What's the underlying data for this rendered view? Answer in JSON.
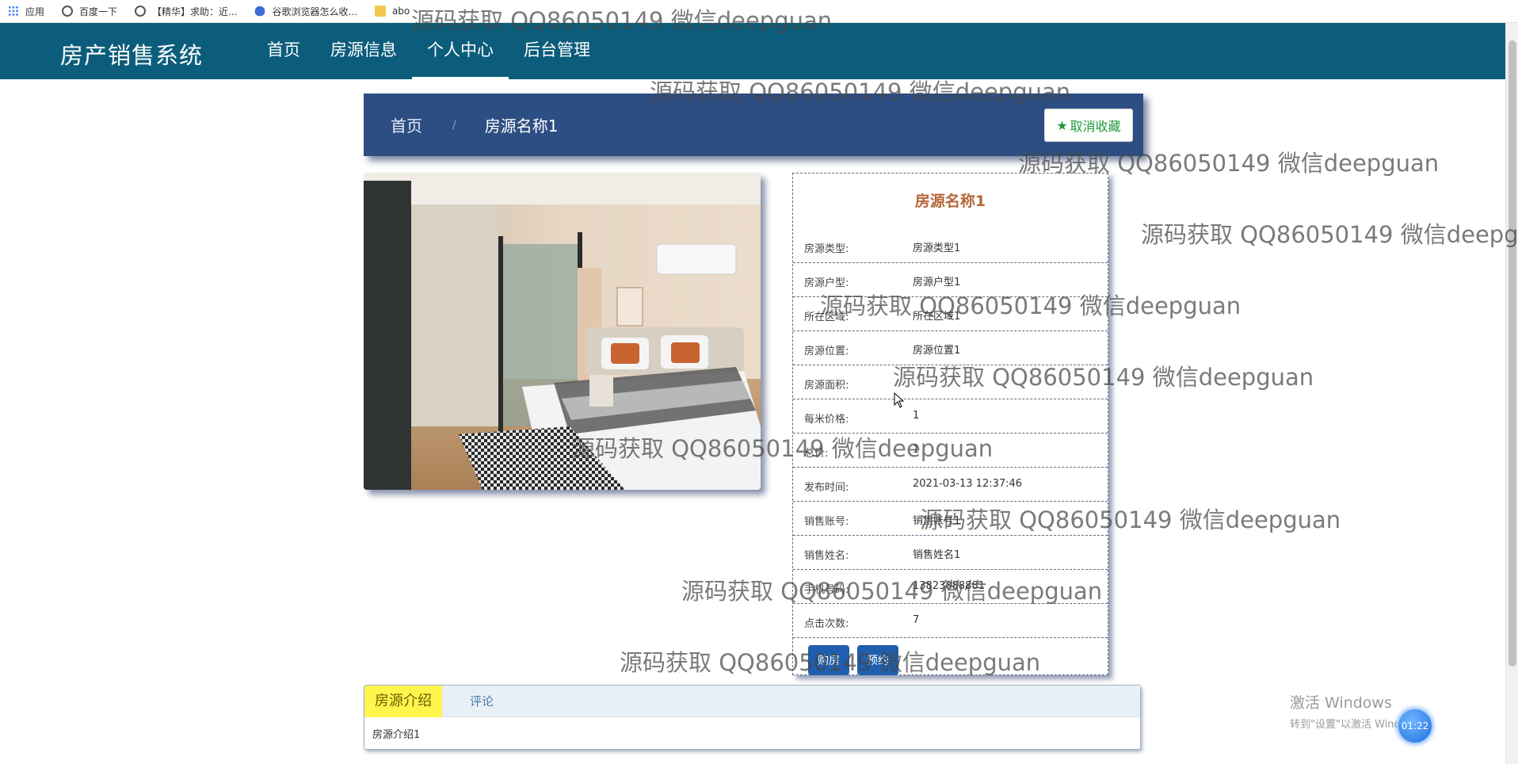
{
  "bookmarks": [
    {
      "label": "应用",
      "icon": "apps-grid-icon"
    },
    {
      "label": "百度一下",
      "icon": "globe-icon"
    },
    {
      "label": "【精华】求助：近...",
      "icon": "globe-icon"
    },
    {
      "label": "谷歌浏览器怎么收...",
      "icon": "paw-icon"
    },
    {
      "label": "abo",
      "icon": "folder-icon"
    }
  ],
  "nav": {
    "brand": "房产销售系统",
    "links": [
      {
        "label": "首页"
      },
      {
        "label": "房源信息"
      },
      {
        "label": "个人中心",
        "active": true
      },
      {
        "label": "后台管理"
      }
    ]
  },
  "breadcrumb": {
    "home": "首页",
    "separator": "/",
    "current": "房源名称1",
    "favorite_button": "取消收藏"
  },
  "detail": {
    "title": "房源名称1",
    "rows": [
      {
        "label": "房源类型:",
        "value": "房源类型1"
      },
      {
        "label": "房源户型:",
        "value": "房源户型1"
      },
      {
        "label": "所在区域:",
        "value": "所在区域1"
      },
      {
        "label": "房源位置:",
        "value": "房源位置1"
      },
      {
        "label": "房源面积:",
        "value": ""
      },
      {
        "label": "每米价格:",
        "value": "1"
      },
      {
        "label": "总价:",
        "value": "1"
      },
      {
        "label": "发布时间:",
        "value": "2021-03-13 12:37:46"
      },
      {
        "label": "销售账号:",
        "value": "销售账号1"
      },
      {
        "label": "销售姓名:",
        "value": "销售姓名1"
      },
      {
        "label": "手机号码:",
        "value": "13823888881"
      },
      {
        "label": "点击次数:",
        "value": "7"
      }
    ],
    "actions": [
      "购房",
      "预约"
    ]
  },
  "tabs": {
    "items": [
      {
        "label": "房源介绍",
        "active": true
      },
      {
        "label": "评论"
      }
    ],
    "content": "房源介绍1"
  },
  "watermark_text": "源码获取 QQ86050149 微信deepguan",
  "os_overlay": {
    "activate_title": "激活 Windows",
    "activate_sub": "转到\"设置\"以激活 Windows。",
    "timer": "01:22"
  }
}
